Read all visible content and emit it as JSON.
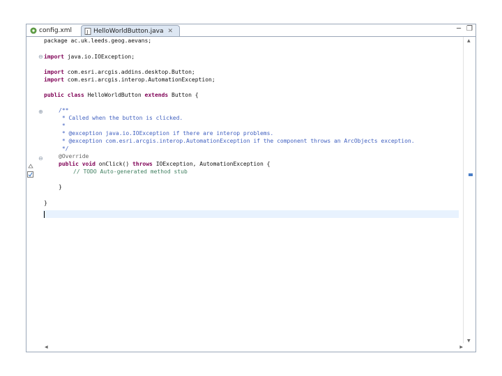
{
  "tabs": [
    {
      "label": "config.xml",
      "active": false
    },
    {
      "label": "HelloWorldButton.java",
      "active": true
    }
  ],
  "window_controls": {
    "minimize": "─",
    "maximize": "❐"
  },
  "code": {
    "l1": "package ac.uk.leeds.geog.aevans;",
    "l2_kw": "import",
    "l2_rest": " java.io.IOException;",
    "l3_kw": "import",
    "l3_rest": " com.esri.arcgis.addins.desktop.Button;",
    "l4_kw": "import",
    "l4_rest": " com.esri.arcgis.interop.AutomationException;",
    "l5_kw1": "public class",
    "l5_mid": " HelloWorldButton ",
    "l5_kw2": "extends",
    "l5_rest": " Button {",
    "l6": "/**",
    "l7": " * Called when the button is clicked.",
    "l8": " *",
    "l9": " * @exception java.io.IOException if there are interop problems.",
    "l10": " * @exception com.esri.arcgis.interop.AutomationException if the component throws an ArcObjects exception.",
    "l11": " */",
    "l12": "@Override",
    "l13_kw1": "public void",
    "l13_mid": " onClick() ",
    "l13_kw2": "throws",
    "l13_rest": " IOException, AutomationException {",
    "l14": "// TODO Auto-generated method stub",
    "l15": "}",
    "l16": "}"
  },
  "gutter_icons": [
    "fold-collapse-icon",
    "override-marker-icon",
    "task-marker-icon"
  ],
  "colors": {
    "keyword": "#7f0055",
    "javadoc": "#3f5fbf",
    "todo": "#3f7f5f",
    "current_line": "#e8f2fe",
    "tab_active": "#dde7f3",
    "overview_marker": "#4a7ec7"
  }
}
